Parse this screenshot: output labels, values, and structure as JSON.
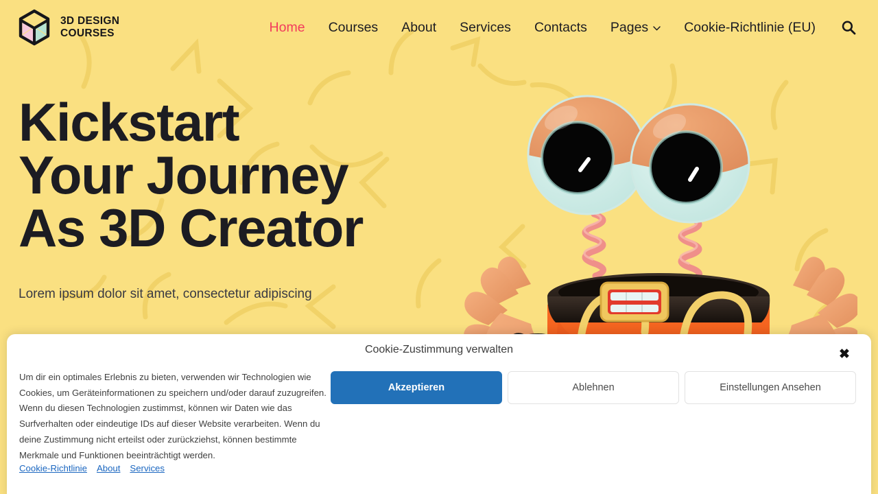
{
  "theme": {
    "page_background": "#FAE081",
    "decor_stroke": "#F3D46A",
    "text_dark": "#1C1C22",
    "accent_pink": "#F23B5C",
    "banner_background": "#FFFFFF",
    "primary_button": "#2271B8",
    "link_blue": "#1A66C0"
  },
  "header": {
    "brand": {
      "logo_icon": "cube-icon",
      "name": "3D DESIGN\nCOURSES",
      "cube_left_face": "#F6C9DC",
      "cube_right_face": "#B6E3D2",
      "cube_top_face": "#FAE081"
    },
    "nav": [
      {
        "label": "Home",
        "active": true,
        "has_dropdown": false
      },
      {
        "label": "Courses",
        "active": false,
        "has_dropdown": false
      },
      {
        "label": "About",
        "active": false,
        "has_dropdown": false
      },
      {
        "label": "Services",
        "active": false,
        "has_dropdown": false
      },
      {
        "label": "Contacts",
        "active": false,
        "has_dropdown": false
      },
      {
        "label": "Pages",
        "active": false,
        "has_dropdown": true
      },
      {
        "label": "Cookie-Richtlinie (EU)",
        "active": false,
        "has_dropdown": false
      }
    ],
    "search_icon": "search-icon"
  },
  "hero": {
    "title": "Kickstart\nYour Journey\nAs 3D Creator",
    "subtitle": "Lorem ipsum dolor sit amet, consectetur adipiscing",
    "illustration": "3d-character-illustration"
  },
  "cookie_banner": {
    "title": "Cookie-Zustimmung verwalten",
    "close_icon": "close-icon",
    "close_glyph": "✖",
    "body": "Um dir ein optimales Erlebnis zu bieten, verwenden wir Technologien wie Cookies, um Geräteinformationen zu speichern und/oder darauf zuzugreifen. Wenn du diesen Technologien zustimmst, können wir Daten wie das Surfverhalten oder eindeutige IDs auf dieser Website verarbeiten. Wenn du deine Zustimmung nicht erteilst oder zurückziehst, können bestimmte Merkmale und Funktionen beeinträchtigt werden.",
    "buttons": {
      "accept": "Akzeptieren",
      "deny": "Ablehnen",
      "preferences": "Einstellungen Ansehen"
    },
    "links": [
      {
        "label": "Cookie-Richtlinie"
      },
      {
        "label": "About"
      },
      {
        "label": "Services"
      }
    ]
  }
}
